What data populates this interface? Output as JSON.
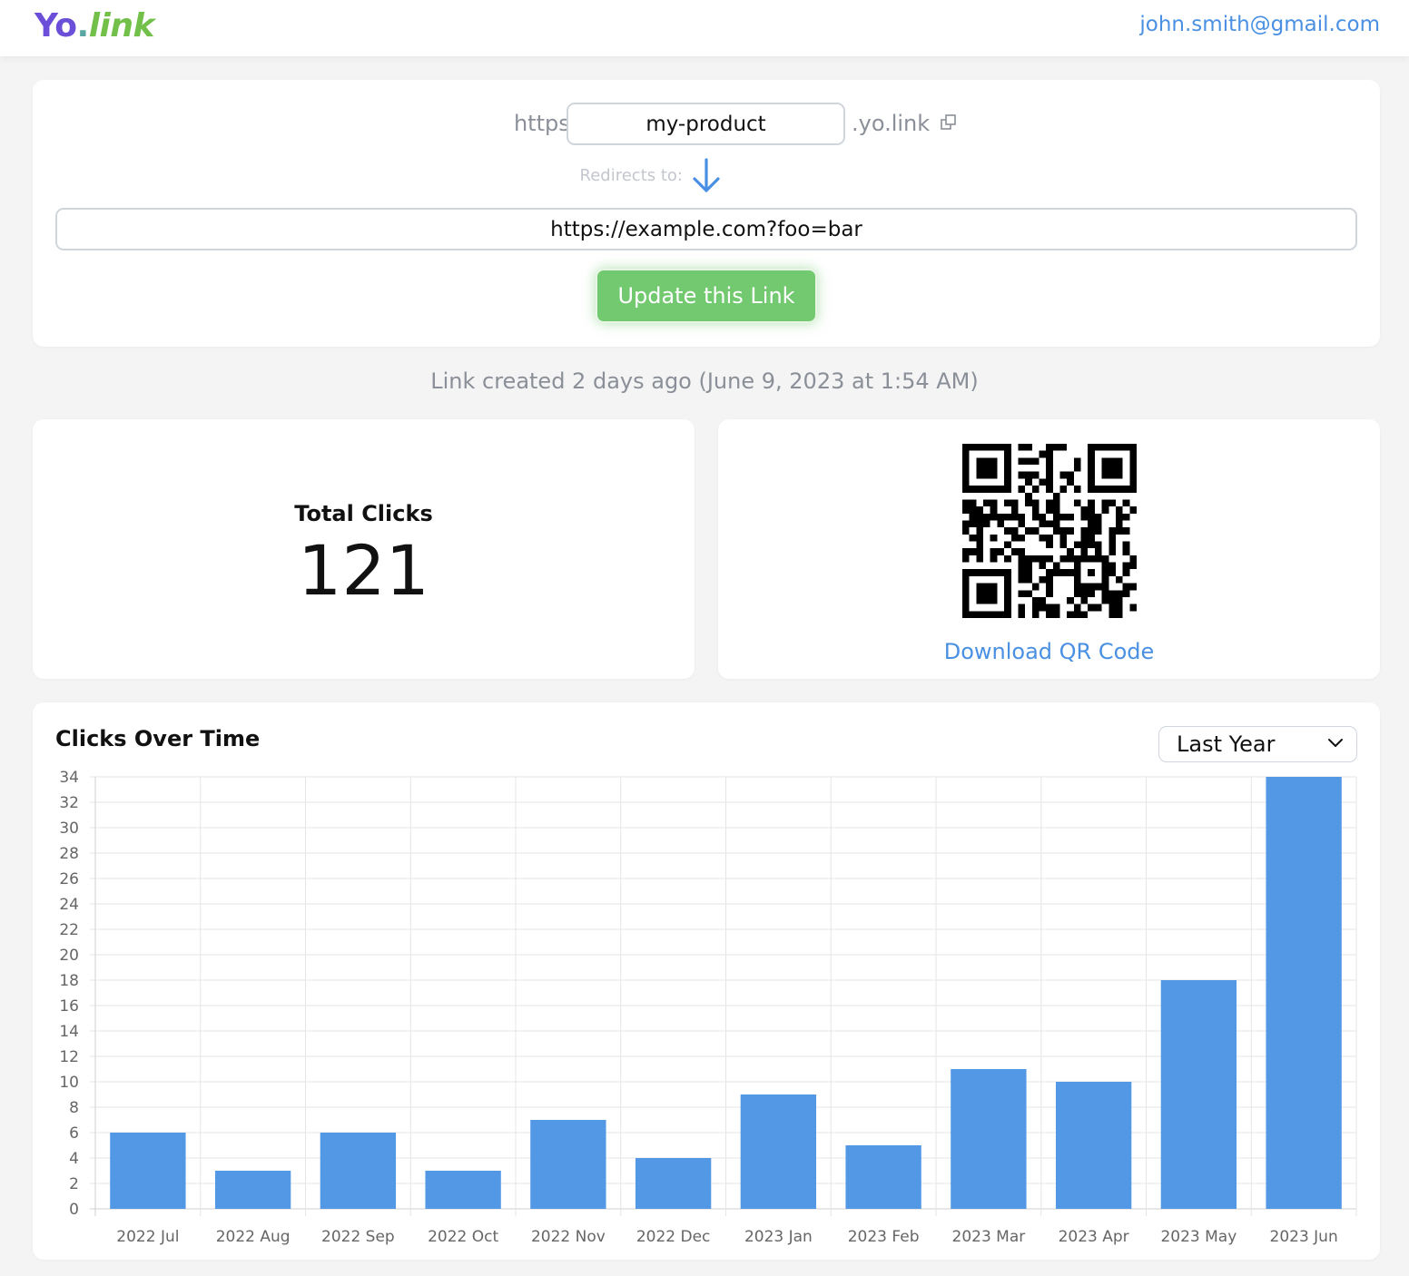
{
  "header": {
    "logo": {
      "part1": "Yo",
      "part2": ".",
      "part3": "link"
    },
    "user_email": "john.smith@gmail.com"
  },
  "link_editor": {
    "prefix": "https://",
    "slug_value": "my-product",
    "suffix": ".yo.link",
    "copy_icon": "copy-icon",
    "redirect_label": "Redirects to:",
    "arrow_icon": "arrow-down-icon",
    "destination_value": "https://example.com?foo=bar",
    "update_button": "Update this Link"
  },
  "created_text": "Link created 2 days ago (June 9, 2023 at 1:54 AM)",
  "stats": {
    "total_clicks_label": "Total Clicks",
    "total_clicks_value": "121"
  },
  "qr": {
    "download_label": "Download QR Code"
  },
  "chart_section": {
    "title": "Clicks Over Time",
    "range_selected": "Last Year"
  },
  "colors": {
    "accent": "#4a90e2",
    "bar": "#5398e5",
    "button": "#72c96f",
    "logo_purple": "#6b4fd8",
    "logo_green": "#72c04a"
  },
  "chart_data": {
    "type": "bar",
    "categories": [
      "2022 Jul",
      "2022 Aug",
      "2022 Sep",
      "2022 Oct",
      "2022 Nov",
      "2022 Dec",
      "2023 Jan",
      "2023 Feb",
      "2023 Mar",
      "2023 Apr",
      "2023 May",
      "2023 Jun"
    ],
    "values": [
      6,
      3,
      6,
      3,
      7,
      4,
      9,
      5,
      11,
      10,
      18,
      34
    ],
    "title": "Clicks Over Time",
    "xlabel": "",
    "ylabel": "",
    "ylim": [
      0,
      34
    ],
    "yticks": [
      0,
      2,
      4,
      6,
      8,
      10,
      12,
      14,
      16,
      18,
      20,
      22,
      24,
      26,
      28,
      30,
      32,
      34
    ],
    "grid": true,
    "legend": "none"
  }
}
